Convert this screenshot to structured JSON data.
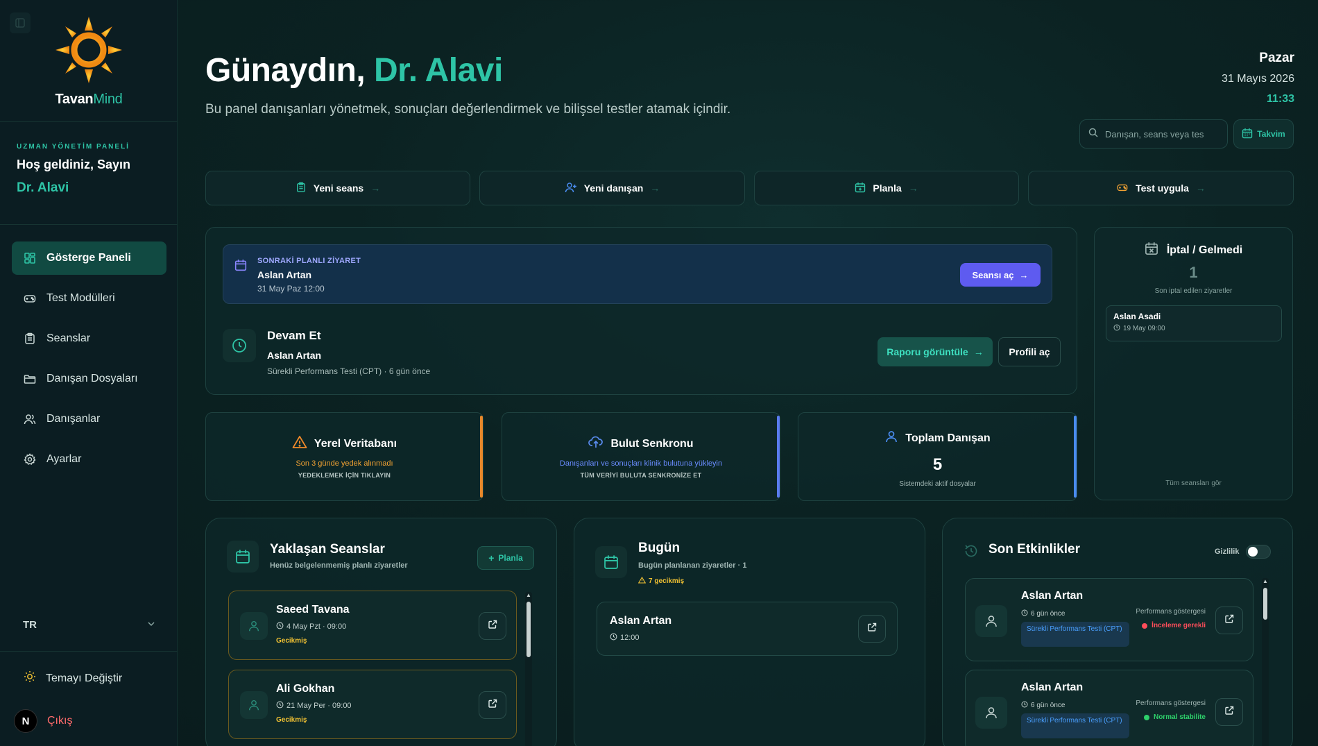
{
  "brand": {
    "name_part1": "Tavan",
    "name_part2": "Mind"
  },
  "sidebar": {
    "kicker": "UZMAN YÖNETİM PANELİ",
    "hello": "Hoş geldiniz, Sayın",
    "user": "Dr. Alavi",
    "items": [
      {
        "label": "Gösterge Paneli",
        "icon": "dashboard-icon",
        "active": true
      },
      {
        "label": "Test Modülleri",
        "icon": "gamepad-icon"
      },
      {
        "label": "Seanslar",
        "icon": "clipboard-icon"
      },
      {
        "label": "Danışan Dosyaları",
        "icon": "folder-icon"
      },
      {
        "label": "Danışanlar",
        "icon": "users-icon"
      },
      {
        "label": "Ayarlar",
        "icon": "gear-icon"
      }
    ],
    "language": "TR",
    "theme_label": "Temayı Değiştir",
    "logout_label": "Çıkış",
    "badge": "N"
  },
  "header": {
    "greet_prefix": "Günaydın, ",
    "greet_name": "Dr. Alavi",
    "subtitle": "Bu panel danışanları yönetmek, sonuçları değerlendirmek ve bilişsel testler atamak içindir.",
    "day": "Pazar",
    "date": "31 Mayıs 2026",
    "time": "11:33",
    "search_placeholder": "Danışan, seans veya tes",
    "calendar_label": "Takvim"
  },
  "quick_actions": [
    {
      "label": "Yeni seans",
      "icon": "clipboard-icon"
    },
    {
      "label": "Yeni danışan",
      "icon": "user-plus-icon"
    },
    {
      "label": "Planla",
      "icon": "calendar-plus-icon"
    },
    {
      "label": "Test uygula",
      "icon": "gamepad-icon"
    }
  ],
  "next_visit": {
    "kicker": "SONRAKİ PLANLI ZİYARET",
    "name": "Aslan Artan",
    "date": "31 May Paz 12:00",
    "button": "Seansı aç"
  },
  "resume": {
    "title": "Devam Et",
    "name": "Aslan Artan",
    "desc": "Sürekli Performans Testi (CPT) · 6 gün önce",
    "report_button": "Raporu görüntüle",
    "profile_button": "Profili aç"
  },
  "cancellations": {
    "title": "İptal / Gelmedi",
    "count": "1",
    "sub": "Son iptal edilen ziyaretler",
    "item_name": "Aslan Asadi",
    "item_date": "19 May 09:00",
    "footer": "Tüm seansları gör"
  },
  "stats": {
    "local": {
      "title": "Yerel Veritabanı",
      "line1": "Son 3 günde yedek alınmadı",
      "line2": "YEDEKLEMEK İÇİN TIKLAYIN",
      "accent": "#e8882a"
    },
    "cloud": {
      "title": "Bulut Senkronu",
      "line1": "Danışanları ve sonuçları klinik bulutuna yükleyin",
      "line2": "TÜM VERİYİ BULUTA SENKRONİZE ET",
      "accent": "#5a7cf0"
    },
    "total": {
      "title": "Toplam Danışan",
      "value": "5",
      "line1": "Sistemdeki aktif dosyalar",
      "accent": "#4a8cf0"
    }
  },
  "upcoming": {
    "title": "Yaklaşan Seanslar",
    "sub": "Henüz belgelenmemiş planlı ziyaretler",
    "plan_button": "Planla",
    "sessions": [
      {
        "name": "Saeed Tavana",
        "date": "4 May Pzt · 09:00",
        "status": "Gecikmiş"
      },
      {
        "name": "Ali Gokhan",
        "date": "21 May Per · 09:00",
        "status": "Gecikmiş"
      }
    ]
  },
  "today": {
    "title": "Bugün",
    "sub": "Bugün planlanan ziyaretler · 1",
    "warning": "7 gecikmiş",
    "item_name": "Aslan Artan",
    "item_time": "12:00"
  },
  "activities": {
    "title": "Son Etkinlikler",
    "privacy_label": "Gizlilik",
    "items": [
      {
        "name": "Aslan Artan",
        "ago": "6 gün önce",
        "tag": "Sürekli Performans Testi (CPT)",
        "perf_label": "Performans göstergesi",
        "status": "İnceleme gerekli",
        "status_color": "#ff4d5a"
      },
      {
        "name": "Aslan Artan",
        "ago": "6 gün önce",
        "tag": "Sürekli Performans Testi (CPT)",
        "perf_label": "Performans göstergesi",
        "status": "Normal stabilite",
        "status_color": "#2ed06b"
      }
    ]
  }
}
